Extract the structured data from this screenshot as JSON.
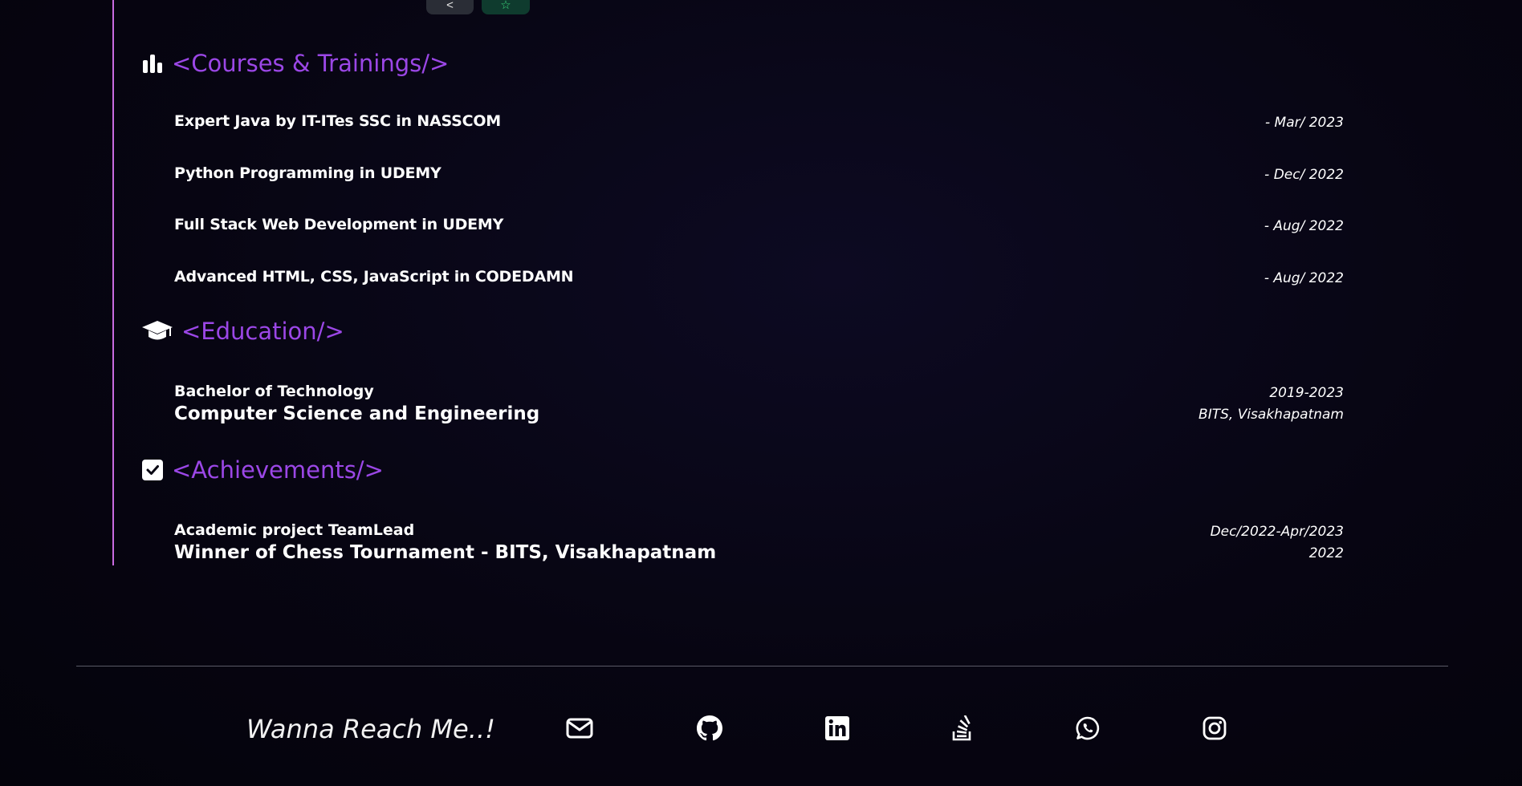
{
  "top_chips": {
    "left_glyph": "<",
    "right_glyph": "☆"
  },
  "courses": {
    "heading": "<Courses & Trainings/>",
    "icon": "bar-chart-icon",
    "items": [
      {
        "title": "Expert Java by IT-ITes SSC in NASSCOM",
        "date": "- Mar/ 2023"
      },
      {
        "title": "Python Programming in UDEMY",
        "date": "- Dec/ 2022"
      },
      {
        "title": "Full Stack Web Development in UDEMY",
        "date": "- Aug/ 2022"
      },
      {
        "title": "Advanced HTML, CSS, JavaScript in CODEDAMN",
        "date": "- Aug/ 2022"
      }
    ]
  },
  "education": {
    "heading": "<Education/>",
    "icon": "graduation-cap-icon",
    "degree": "Bachelor of Technology",
    "major": "Computer Science and Engineering",
    "years": "2019-2023",
    "institution": "BITS, Visakhapatnam"
  },
  "achievements": {
    "heading": "<Achievements/>",
    "icon": "checkbox-icon",
    "line1": "Academic project TeamLead",
    "line2": "Winner of Chess Tournament - BITS, Visakhapatnam",
    "date1": "Dec/2022-Apr/2023",
    "date2": "2022"
  },
  "footer": {
    "reach_text": "Wanna Reach Me..!",
    "links": [
      "email-icon",
      "github-icon",
      "linkedin-icon",
      "stackoverflow-icon",
      "whatsapp-icon",
      "instagram-icon"
    ]
  },
  "colors": {
    "accent": "#9b47e6",
    "timeline": "#c86be0",
    "background": "#070512"
  }
}
